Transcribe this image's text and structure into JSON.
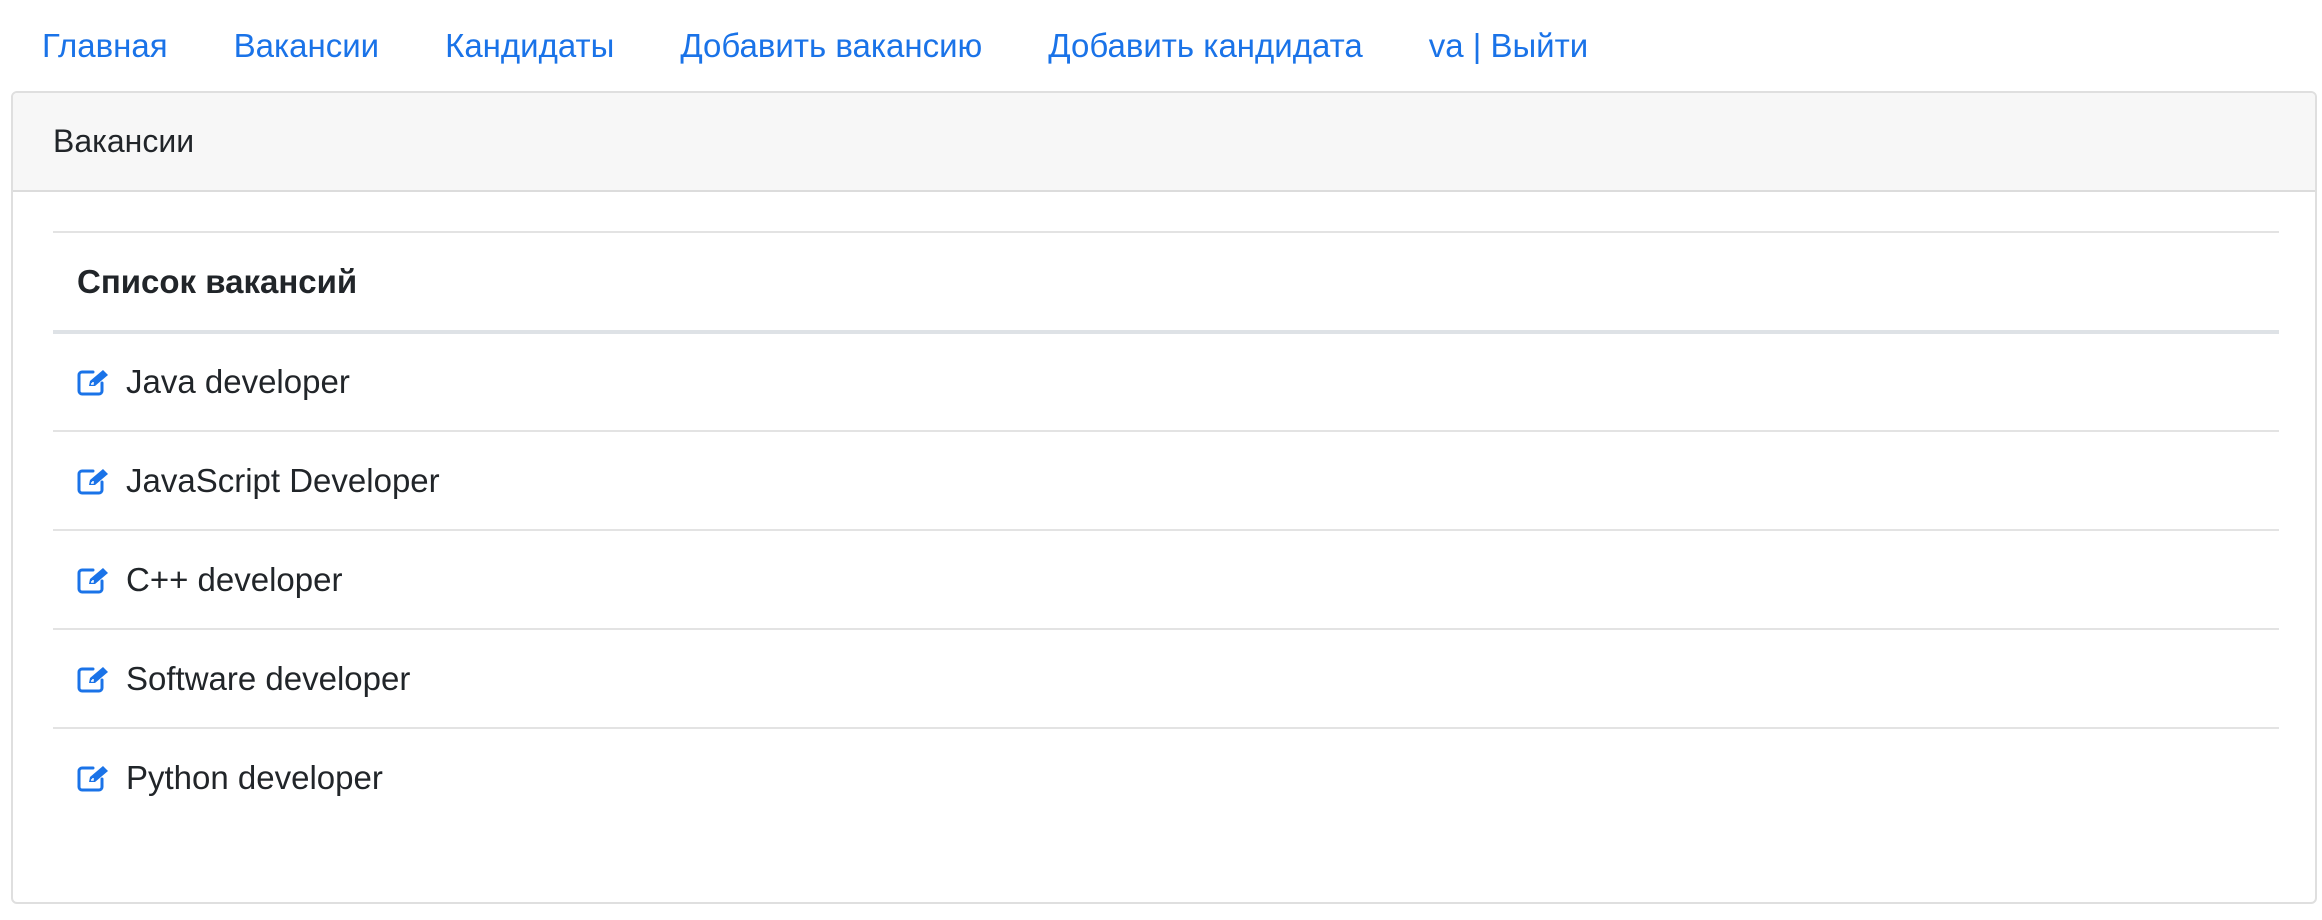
{
  "nav": {
    "items": [
      {
        "label": "Главная"
      },
      {
        "label": "Вакансии"
      },
      {
        "label": "Кандидаты"
      },
      {
        "label": "Добавить вакансию"
      },
      {
        "label": "Добавить кандидата"
      },
      {
        "label": "va | Выйти"
      }
    ]
  },
  "card": {
    "header": "Вакансии",
    "table": {
      "column_header": "Список вакансий",
      "rows": [
        {
          "icon": "edit-icon",
          "title": "Java developer"
        },
        {
          "icon": "edit-icon",
          "title": "JavaScript Developer"
        },
        {
          "icon": "edit-icon",
          "title": "C++ developer"
        },
        {
          "icon": "edit-icon",
          "title": "Software developer"
        },
        {
          "icon": "edit-icon",
          "title": "Python developer"
        }
      ]
    }
  },
  "colors": {
    "link": "#1a73e8",
    "header_bg": "#f7f7f7",
    "text": "#212529"
  }
}
